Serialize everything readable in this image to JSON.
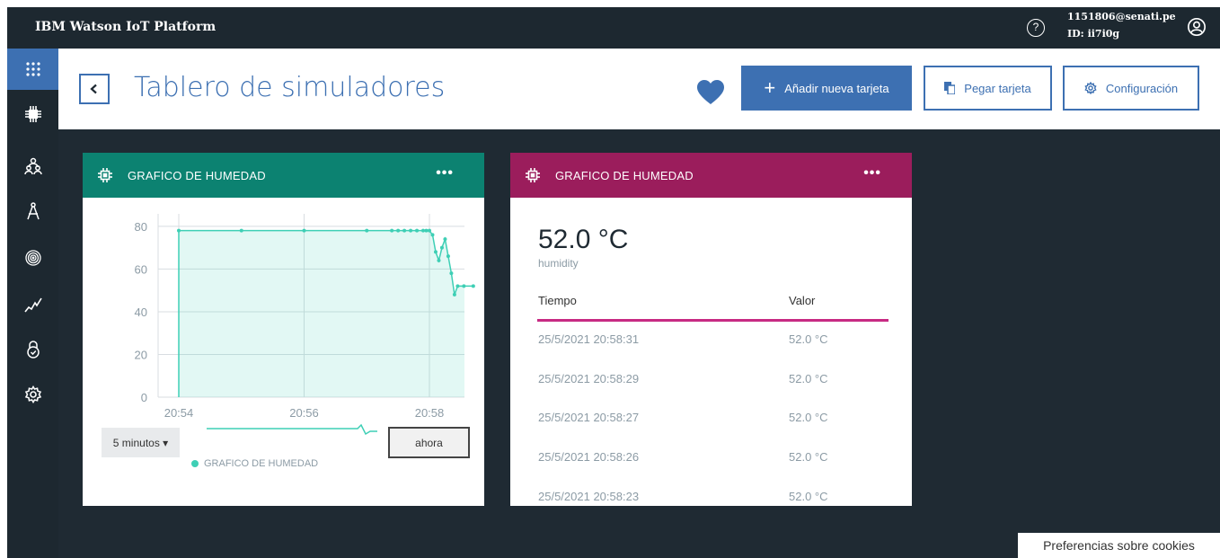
{
  "topbar": {
    "brand": "IBM Watson IoT Platform",
    "help_icon": "?",
    "user_email": "1151806@senati.pe",
    "user_id": "ID: ii7i0g"
  },
  "sidebar": {
    "items": [
      {
        "icon": "apps-grid-icon",
        "active": true
      },
      {
        "icon": "chip-icon"
      },
      {
        "icon": "members-icon"
      },
      {
        "icon": "compass-icon"
      },
      {
        "icon": "fingerprint-icon"
      },
      {
        "icon": "analytics-icon"
      },
      {
        "icon": "security-icon"
      },
      {
        "icon": "gear-icon"
      }
    ]
  },
  "header": {
    "title": "Tablero de simuladores",
    "add_card_label": "Añadir nueva tarjeta",
    "add_card_plus": "+",
    "paste_card_label": "Pegar tarjeta",
    "settings_label": "Configuración"
  },
  "colors": {
    "accent": "#3d70b2",
    "card_green": "#0c8271",
    "card_magenta": "#9b1d5c",
    "chart_line": "#3ecfb5",
    "table_rule": "#c72a83"
  },
  "chart_card": {
    "title": "GRAFICO DE HUMEDAD",
    "menu": "•••",
    "range_select": "5 minutos ▾",
    "now_button": "ahora",
    "legend": "GRAFICO DE HUMEDAD"
  },
  "chart_data": {
    "type": "area",
    "x_ticks": [
      "20:54",
      "20:56",
      "20:58"
    ],
    "y_ticks": [
      "0",
      "20",
      "40",
      "60",
      "80"
    ],
    "ylim": [
      0,
      85
    ],
    "x_range_min": [
      0,
      9.2
    ],
    "x_tick_minutes": [
      0.6,
      2.6,
      4.6
    ],
    "series": [
      {
        "name": "GRAFICO DE HUMEDAD",
        "points": [
          [
            0.6,
            78
          ],
          [
            1.6,
            78
          ],
          [
            2.6,
            78
          ],
          [
            3.6,
            78
          ],
          [
            4.0,
            78
          ],
          [
            4.1,
            78
          ],
          [
            4.2,
            78
          ],
          [
            4.3,
            78
          ],
          [
            4.4,
            78
          ],
          [
            4.5,
            78
          ],
          [
            4.55,
            78
          ],
          [
            4.6,
            78
          ],
          [
            4.65,
            76
          ],
          [
            4.7,
            68
          ],
          [
            4.75,
            64
          ],
          [
            4.8,
            70
          ],
          [
            4.85,
            74
          ],
          [
            4.9,
            66
          ],
          [
            4.95,
            58
          ],
          [
            5.0,
            48
          ],
          [
            5.05,
            52
          ],
          [
            5.15,
            52
          ],
          [
            5.3,
            52
          ]
        ]
      }
    ],
    "grid": true
  },
  "value_card": {
    "title": "GRAFICO DE HUMEDAD",
    "menu": "•••",
    "value": "52.0 °C",
    "unit_label": "humidity",
    "col_time": "Tiempo",
    "col_value": "Valor",
    "rows": [
      {
        "time": "25/5/2021 20:58:31",
        "value": "52.0 °C"
      },
      {
        "time": "25/5/2021 20:58:29",
        "value": "52.0 °C"
      },
      {
        "time": "25/5/2021 20:58:27",
        "value": "52.0 °C"
      },
      {
        "time": "25/5/2021 20:58:26",
        "value": "52.0 °C"
      },
      {
        "time": "25/5/2021 20:58:23",
        "value": "52.0 °C"
      }
    ]
  },
  "cookie_banner": "Preferencias sobre cookies"
}
